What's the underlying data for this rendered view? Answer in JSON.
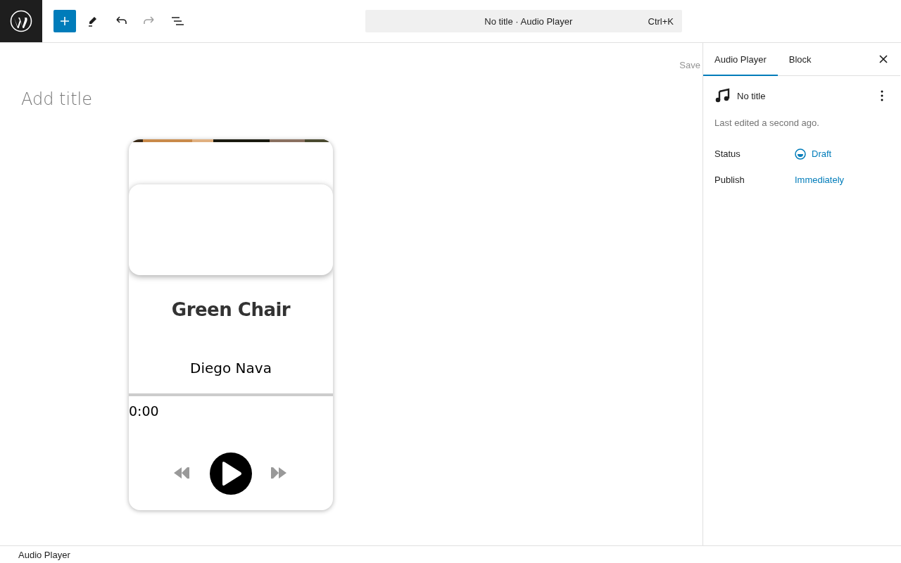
{
  "toolbar": {
    "command_bar": {
      "title": "No title · Audio Player",
      "shortcut": "Ctrl+K"
    },
    "redo_disabled": true
  },
  "editor": {
    "save": "Save",
    "title_placeholder": "Add title",
    "player": {
      "track_title": "Green Chair",
      "artist": "Diego Nava",
      "progress": {
        "level": 0
      },
      "time": "0:00",
      "playing": false
    }
  },
  "sidebar": {
    "tabs": [
      {
        "label": "Audio Player",
        "selected": true
      },
      {
        "label": "Block",
        "selected": false
      }
    ],
    "post_title": "No title",
    "last_edited": "Last edited a second ago.",
    "fields": [
      {
        "label": "Status",
        "value": "Draft",
        "kind": "status"
      },
      {
        "label": "Publish",
        "value": "Immediately",
        "kind": "link"
      }
    ]
  },
  "footer": {
    "breadcrumb": "Audio Player"
  }
}
